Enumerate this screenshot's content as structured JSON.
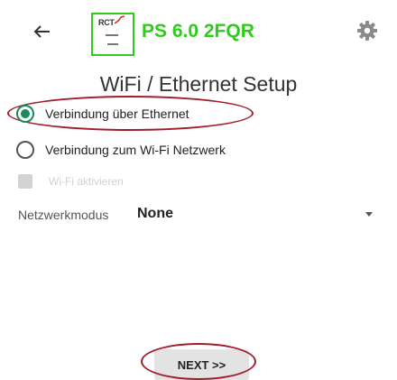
{
  "header": {
    "back_icon": "arrow-left-icon",
    "logo": {
      "brand_text": "RCT",
      "accent_color": "#d62828"
    },
    "device_title": "PS 6.0 2FQR",
    "device_title_color": "#2ecc1a",
    "settings_icon": "gear-icon"
  },
  "page": {
    "title": "WiFi / Ethernet Setup"
  },
  "connection": {
    "options": [
      {
        "label": "Verbindung über Ethernet",
        "selected": true
      },
      {
        "label": "Verbindung zum Wi-Fi Netzwerk",
        "selected": false
      }
    ],
    "wifi_checkbox_label": "Wi-Fi aktivieren",
    "wifi_checkbox_enabled": false
  },
  "network_mode": {
    "label": "Netzwerkmodus",
    "value": "None",
    "dropdown_icon": "caret-down-icon"
  },
  "footer": {
    "next_label": "NEXT >>"
  },
  "colors": {
    "accent_radio": "#1a8a5a",
    "annotation_ring": "#a01e2a"
  }
}
